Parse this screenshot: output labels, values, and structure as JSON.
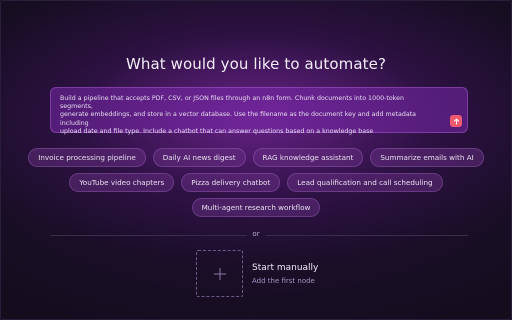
{
  "heading": "What would you like to automate?",
  "prompt": {
    "text": "Build a pipeline that accepts PDF, CSV, or JSON files through an n8n form. Chunk documents into 1000-token segments,\ngenerate embeddings, and store in a vector database. Use the filename as the document key and add metadata including\nupload date and file type. Include a chatbot that can answer questions based on a knowledge base",
    "send_icon": "arrow-up-icon"
  },
  "suggestions": {
    "row1": [
      "Invoice processing pipeline",
      "Daily AI news digest",
      "RAG knowledge assistant",
      "Summarize emails with AI"
    ],
    "row2": [
      "YouTube video chapters",
      "Pizza delivery chatbot",
      "Lead qualification and call scheduling"
    ],
    "row3": [
      "Multi-agent research workflow"
    ]
  },
  "divider_label": "or",
  "manual": {
    "title": "Start manually",
    "subtitle": "Add the first node",
    "icon": "plus-icon"
  },
  "colors": {
    "background": "#130d1c",
    "accent_send": "#ef5a70",
    "subtitle": "#a593c2"
  }
}
